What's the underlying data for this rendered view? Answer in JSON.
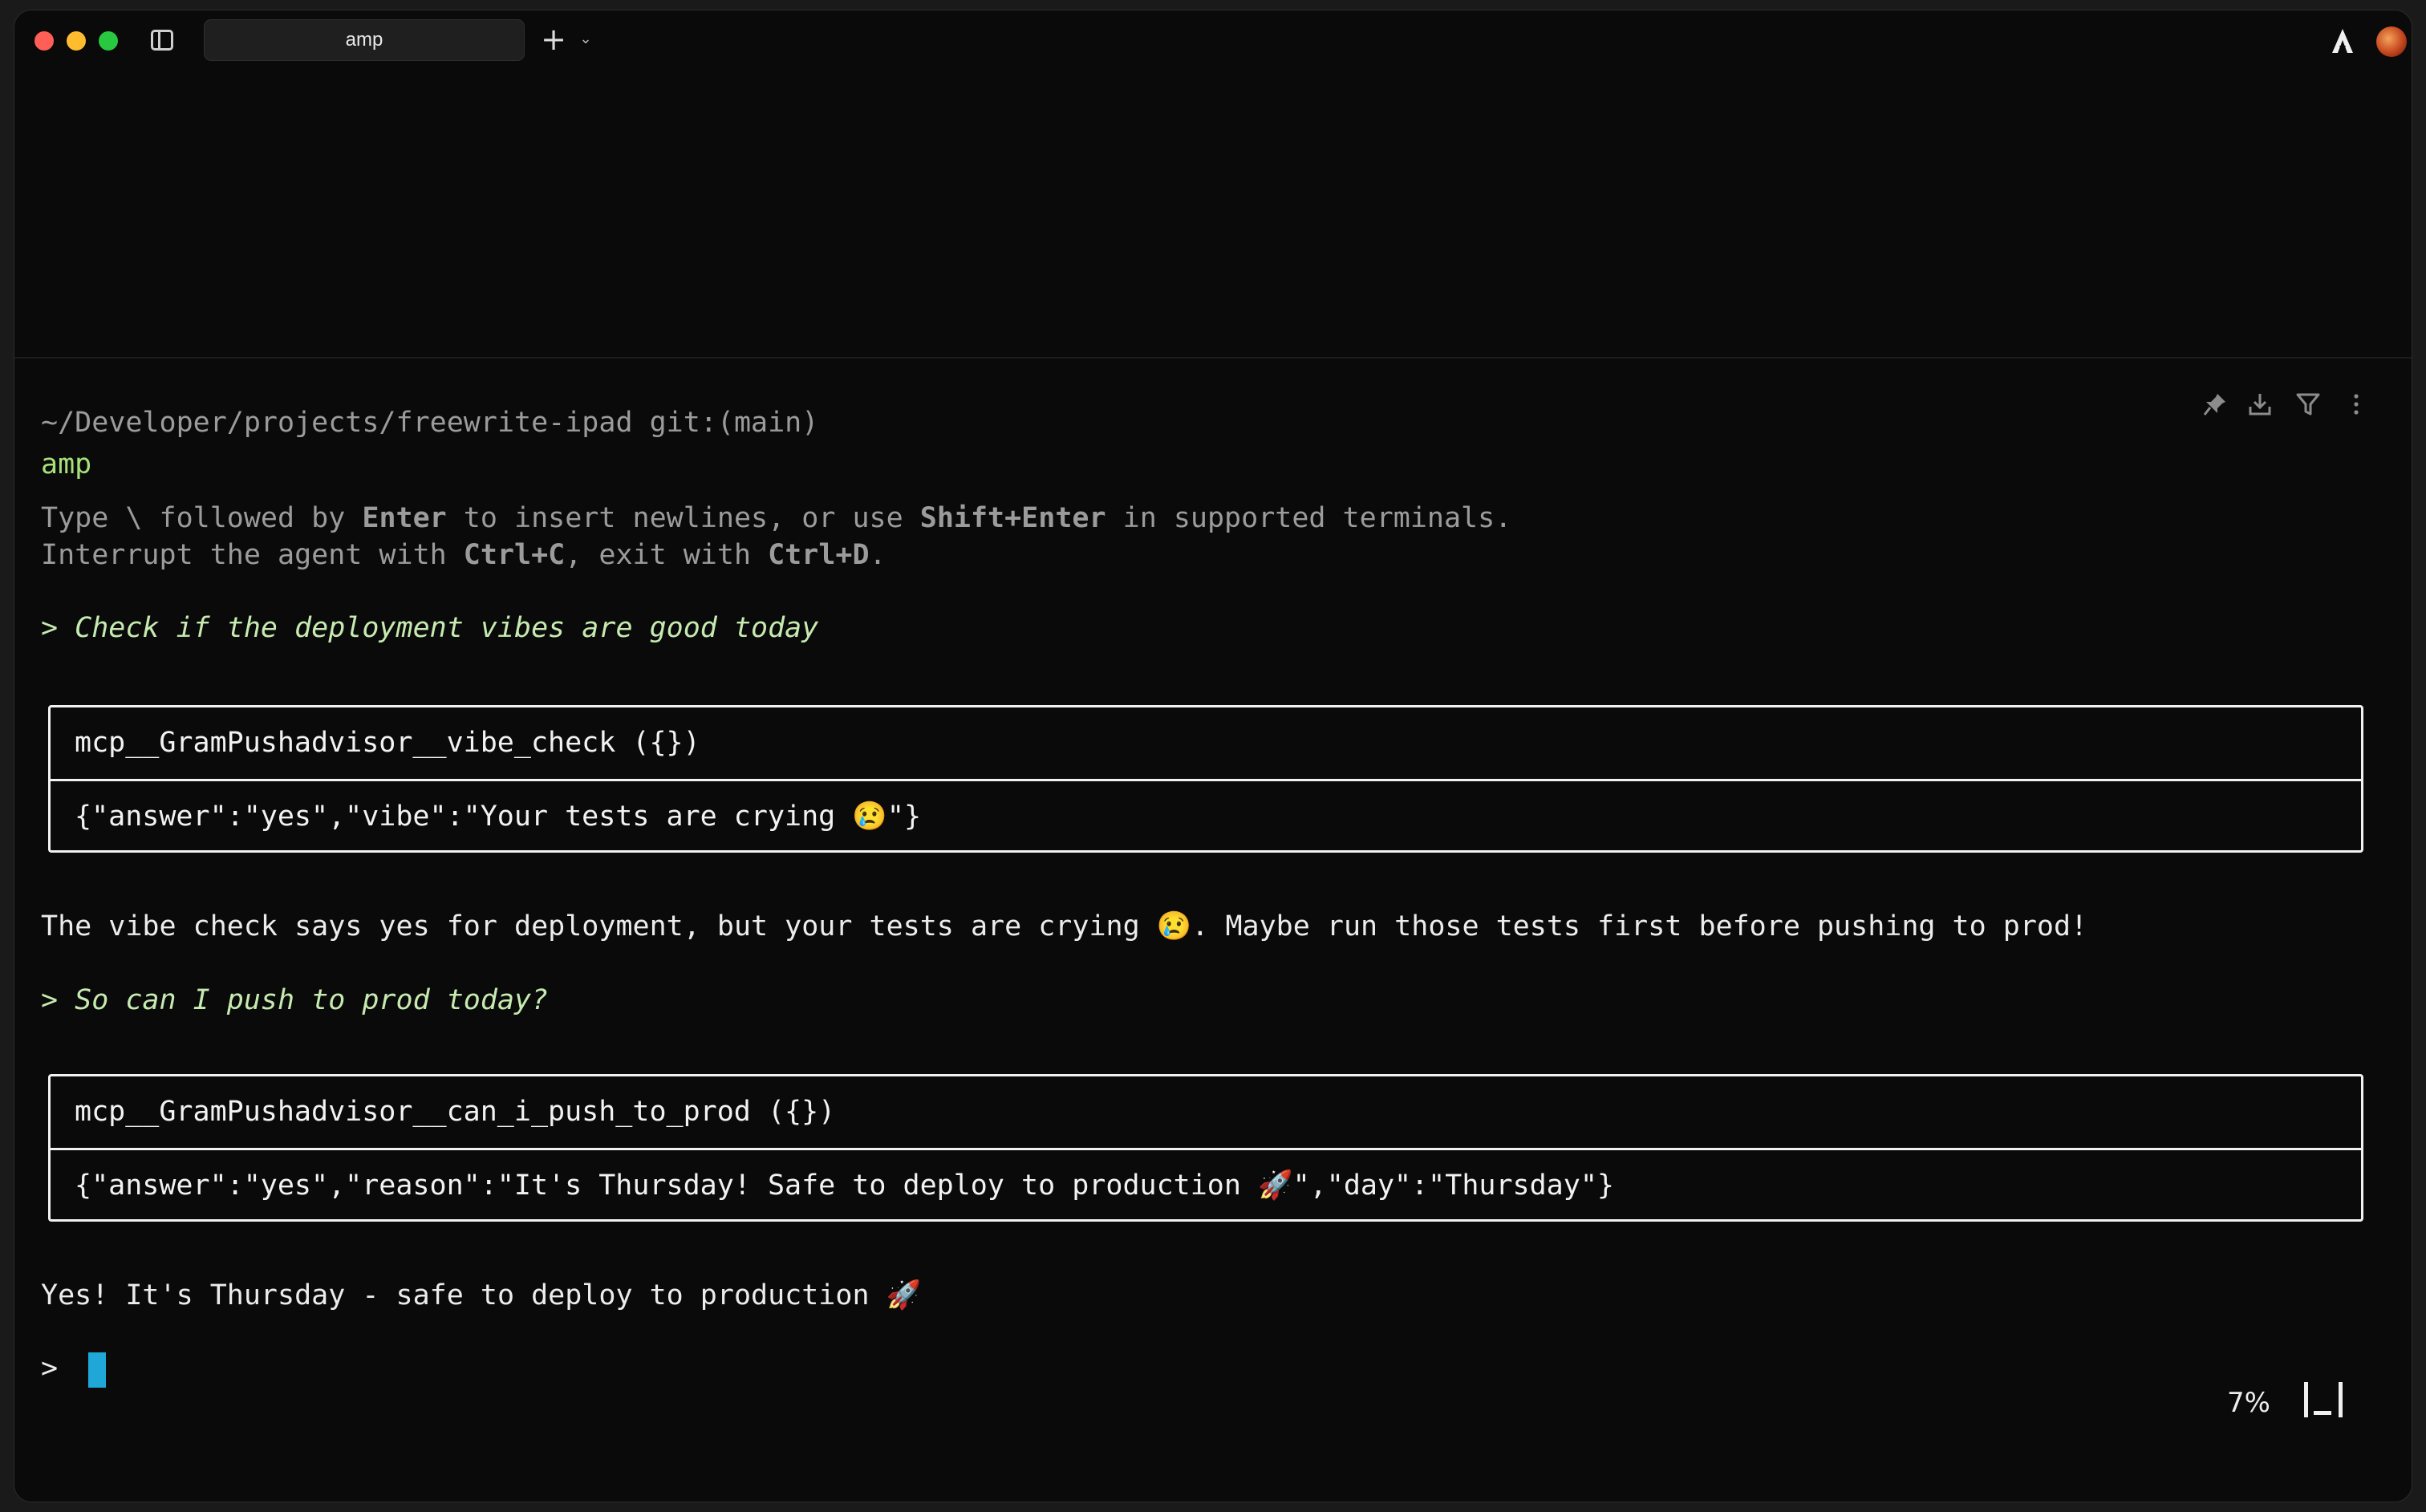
{
  "window": {
    "tab_title": "amp",
    "new_tab_glyph": "+",
    "tab_menu_glyph": "⌄"
  },
  "terminal": {
    "cwd_line": "~/Developer/projects/freewrite-ipad git:(main)",
    "command": "amp",
    "help": {
      "l1_a": "Type \\ followed by ",
      "l1_b": "Enter",
      "l1_c": " to insert newlines, or use ",
      "l1_d": "Shift+Enter",
      "l1_e": " in supported terminals.",
      "l2_a": "Interrupt the agent with ",
      "l2_b": "Ctrl+C",
      "l2_c": ", exit with ",
      "l2_d": "Ctrl+D",
      "l2_e": "."
    },
    "exchanges": [
      {
        "prompt": "> Check if the deployment vibes are good today",
        "tool_call": "mcp__GramPushadvisor__vibe_check ({})",
        "tool_result": "{\"answer\":\"yes\",\"vibe\":\"Your tests are crying 😢\"}",
        "response": "The vibe check says yes for deployment, but your tests are crying 😢. Maybe run those tests first before pushing to prod!"
      },
      {
        "prompt": "> So can I push to prod today?",
        "tool_call": "mcp__GramPushadvisor__can_i_push_to_prod ({})",
        "tool_result": "{\"answer\":\"yes\",\"reason\":\"It's Thursday! Safe to deploy to production 🚀\",\"day\":\"Thursday\"}",
        "response": "Yes! It's Thursday - safe to deploy to production 🚀"
      }
    ],
    "input_prompt": ">",
    "status_percent": "7%"
  },
  "icons": {
    "toolbar": [
      "pin-icon",
      "download-icon",
      "filter-icon",
      "more-vertical-icon"
    ],
    "app": "amp-logo-icon"
  },
  "colors": {
    "background": "#0a0a0a",
    "prompt_green": "#c6eab0",
    "command_green": "#a8e07a",
    "cursor": "#1fa7d8"
  }
}
